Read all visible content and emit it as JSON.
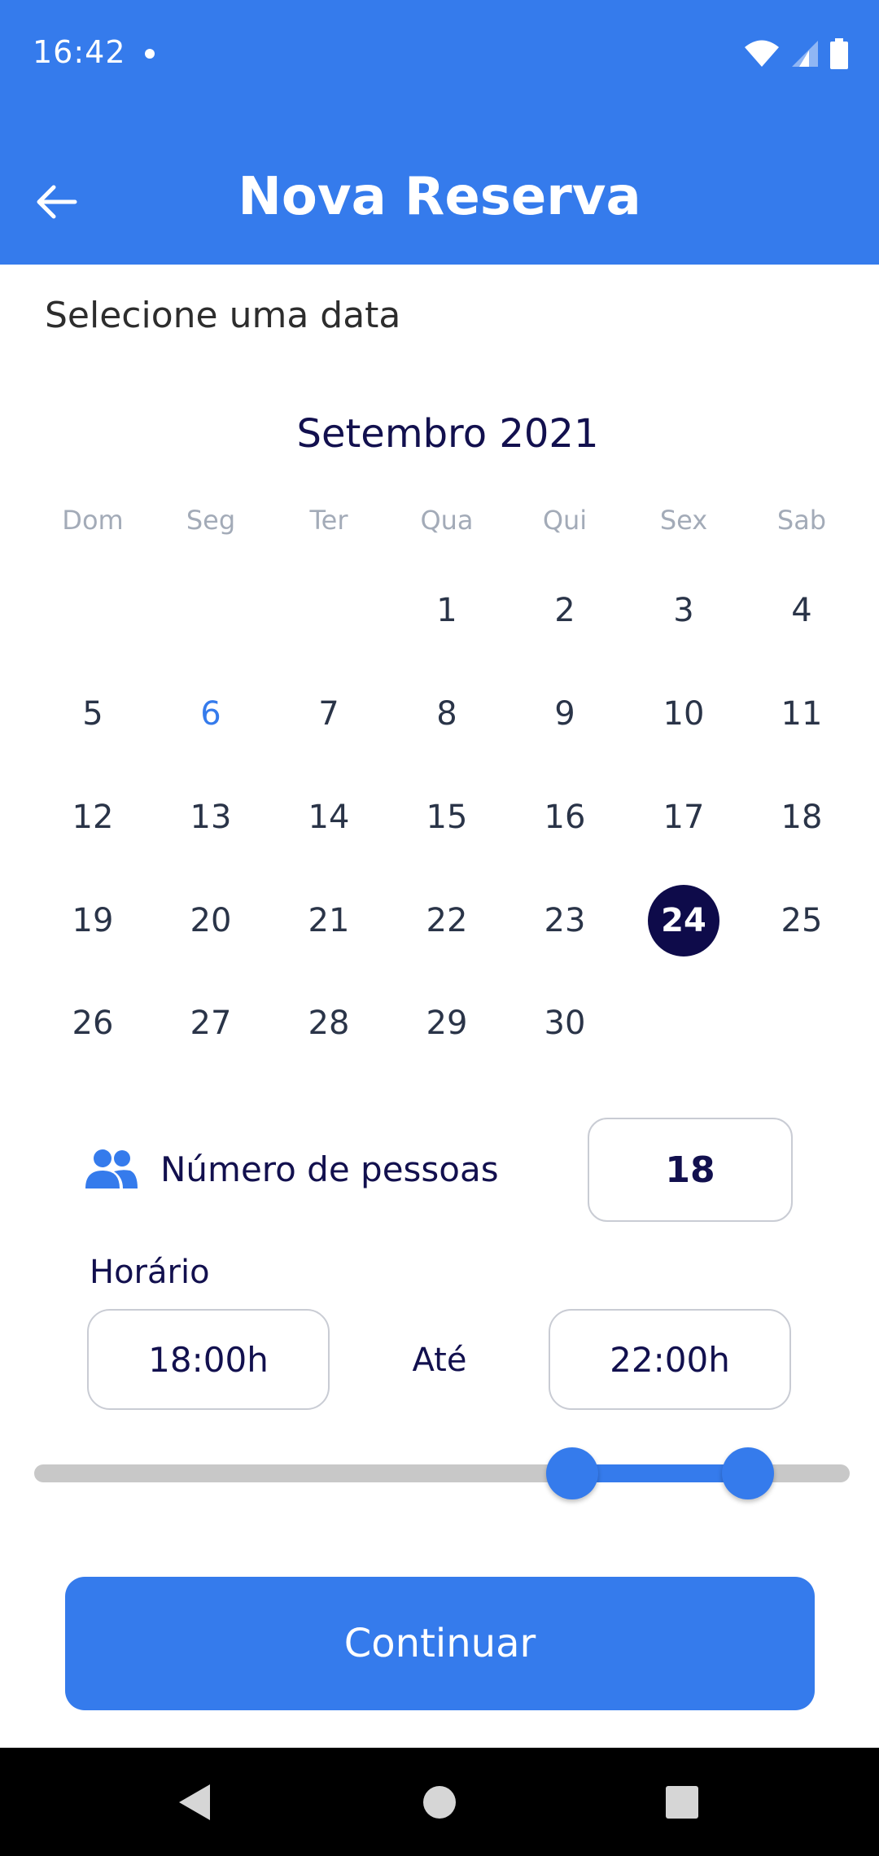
{
  "status_bar": {
    "time": "16:42",
    "icons": [
      "wifi-icon",
      "signal-icon",
      "battery-icon"
    ]
  },
  "app_bar": {
    "title": "Nova Reserva",
    "back_icon": "arrow-left-icon"
  },
  "section_title": "Selecione uma data",
  "calendar": {
    "month_label": "Setembro 2021",
    "weekdays": [
      "Dom",
      "Seg",
      "Ter",
      "Qua",
      "Qui",
      "Sex",
      "Sab"
    ],
    "days": [
      "1",
      "2",
      "3",
      "4",
      "5",
      "6",
      "7",
      "8",
      "9",
      "10",
      "11",
      "12",
      "13",
      "14",
      "15",
      "16",
      "17",
      "18",
      "19",
      "20",
      "21",
      "22",
      "23",
      "24",
      "25",
      "26",
      "27",
      "28",
      "29",
      "30"
    ],
    "first_weekday_index": 3,
    "today": "6",
    "selected": "24"
  },
  "people": {
    "icon": "people-icon",
    "label": "Número de pessoas",
    "value": "18"
  },
  "hours": {
    "label": "Horário",
    "start": "18:00h",
    "separator": "Até",
    "end": "22:00h"
  },
  "slider": {
    "range_start_fraction": 0.66,
    "range_end_fraction": 0.875
  },
  "continue_button": {
    "label": "Continuar"
  },
  "colors": {
    "primary": "#357bec",
    "navy": "#12104e",
    "selected_day_bg": "#0e0b4a",
    "weekday_text": "#a3abb8"
  },
  "nav_bar": {
    "icons": [
      "back-triangle-icon",
      "home-circle-icon",
      "recents-square-icon"
    ]
  }
}
